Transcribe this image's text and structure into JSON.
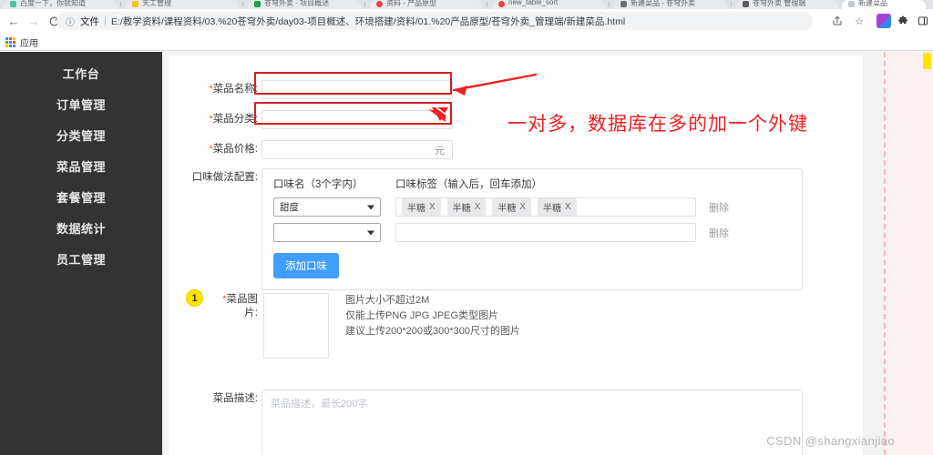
{
  "browser": {
    "tabs": [
      {
        "title": "百度一下，你就知道",
        "favicon_color": "#4bc8a0",
        "active": false
      },
      {
        "title": "天工管理",
        "favicon_color": "#f5c518",
        "active": false
      },
      {
        "title": "苍穹外卖 - 项目概述",
        "favicon_color": "#1aa34a",
        "active": false
      },
      {
        "title": "资料 - 产品原型",
        "favicon_color": "#e8453c",
        "active": false
      },
      {
        "title": "new_table_sort",
        "favicon_color": "#e8453c",
        "active": false
      },
      {
        "title": "新建菜品 - 苍穹外卖",
        "favicon_color": "#6b6b6b",
        "active": false
      },
      {
        "title": "苍穹外卖 管理端",
        "favicon_color": "#5a5a5a",
        "active": false
      },
      {
        "title": "新建菜品",
        "favicon_color": "#9aa0a6",
        "active": true
      }
    ],
    "new_tab_label": "+",
    "nav": {
      "back": "←",
      "forward": "→",
      "reload": "C",
      "info_icon": "ⓘ",
      "scheme_label": "文件",
      "url": "E:/教学资料/课程资料/03.%20苍穹外卖/day03-项目概述、环境搭建/资料/01.%20产品原型/苍穹外卖_管理端/新建菜品.html",
      "share_icon": "⎋",
      "bookmark_icon": "☆",
      "extension_icon": "ext",
      "puzzle_icon": "🧩",
      "sidepanel_icon": "▯"
    },
    "bookmarks": {
      "apps_label": "应用"
    }
  },
  "sidebar": {
    "items": [
      {
        "label": "工作台"
      },
      {
        "label": "订单管理"
      },
      {
        "label": "分类管理"
      },
      {
        "label": "菜品管理"
      },
      {
        "label": "套餐管理"
      },
      {
        "label": "数据统计"
      },
      {
        "label": "员工管理"
      }
    ]
  },
  "form": {
    "name": {
      "required_mark": "*",
      "label": "菜品名称:",
      "value": "",
      "placeholder": ""
    },
    "category": {
      "required_mark": "*",
      "label": "菜品分类:",
      "value": "",
      "placeholder": "",
      "caret": "▾"
    },
    "price": {
      "required_mark": "*",
      "label": "菜品价格:",
      "value": "",
      "placeholder": "",
      "unit": "元"
    },
    "flavor": {
      "label": "口味做法配置:",
      "col_name_header": "口味名（3个字内）",
      "col_tag_header": "口味标签（输入后，回车添加）",
      "rows": [
        {
          "select_value": "甜度",
          "tags": [
            "半糖",
            "半糖",
            "半糖",
            "半糖"
          ],
          "tag_close": "X",
          "delete_label": "删除"
        },
        {
          "select_value": "",
          "tags": [],
          "tag_close": "X",
          "delete_label": "删除"
        }
      ],
      "add_button": "添加口味"
    },
    "image": {
      "required_mark": "*",
      "label": "菜品图\n片:",
      "tips": [
        "图片大小不超过2M",
        "仅能上传PNG JPG JPEG类型图片",
        "建议上传200*200或300*300尺寸的图片"
      ]
    },
    "description": {
      "label": "菜品描述:",
      "value": "",
      "placeholder": "菜品描述，最长200字"
    }
  },
  "annotations": {
    "note_text": "一对多，数据库在多的加一个外键",
    "badge_1": "1",
    "accent_red": "#f02020",
    "box_red": "#d32020",
    "badge_yellow": "#ffe400"
  },
  "watermark": {
    "text": "CSDN @shangxianjiao"
  }
}
